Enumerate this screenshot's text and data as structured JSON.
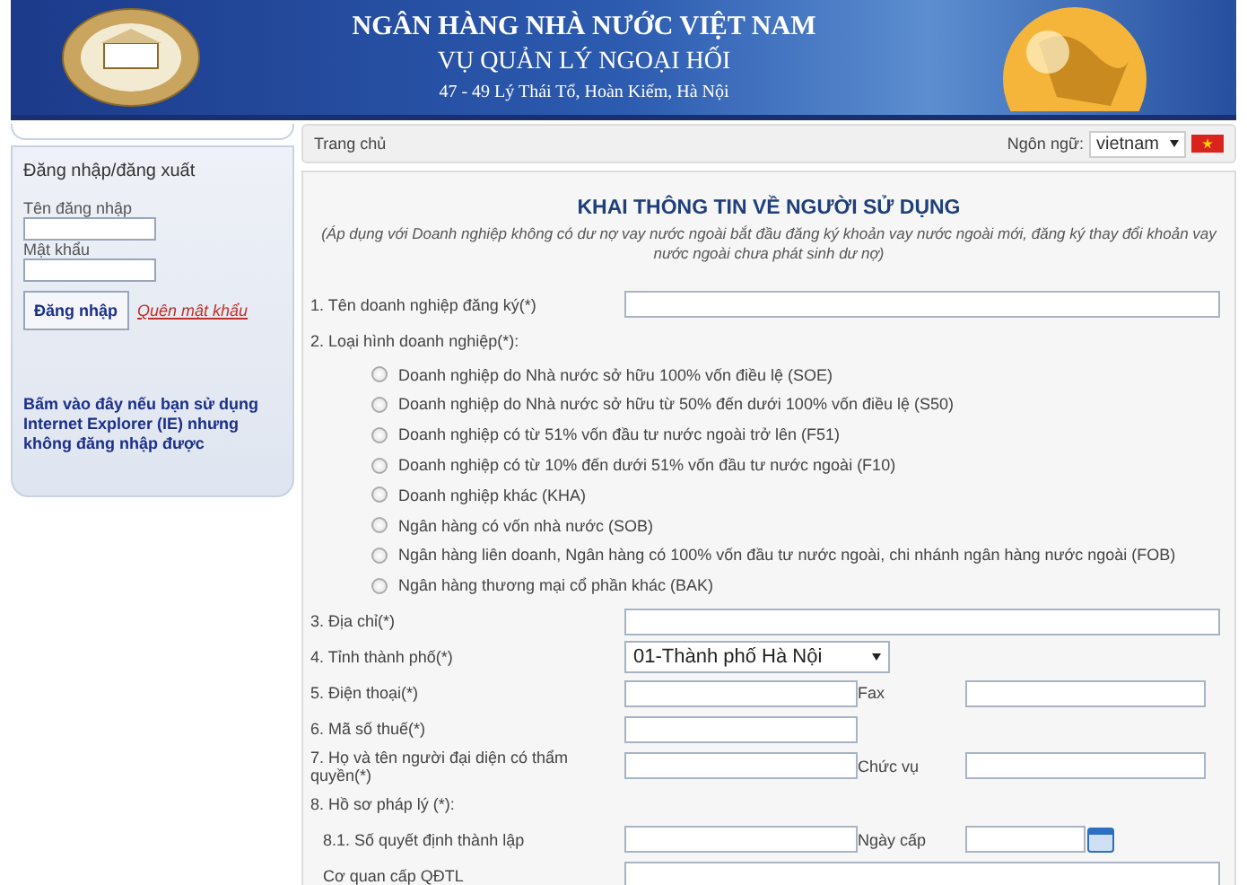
{
  "header": {
    "title": "NGÂN HÀNG NHÀ NƯỚC VIỆT NAM",
    "subtitle": "VỤ QUẢN LÝ NGOẠI HỐI",
    "address": "47 - 49 Lý Thái Tổ, Hoàn Kiếm, Hà Nội"
  },
  "sidebar": {
    "heading": "Đăng nhập/đăng xuất",
    "username_label": "Tên đăng nhập",
    "password_label": "Mật khẩu",
    "login_button": "Đăng nhập",
    "forgot_link": "Quên mật khẩu",
    "ie_note": "Bấm vào đây nếu bạn sử dụng Internet Explorer (IE) nhưng không đăng nhập được"
  },
  "breadcrumb": "Trang chủ",
  "language": {
    "label": "Ngôn ngữ:",
    "value": "vietnam"
  },
  "form": {
    "title": "KHAI THÔNG TIN VỀ NGƯỜI SỬ DỤNG",
    "note": "(Áp dụng với Doanh nghiệp không có dư nợ vay nước ngoài bắt đầu đăng ký khoản vay nước ngoài mới, đăng ký thay đổi khoản vay nước ngoài chưa phát sinh dư nợ)",
    "rows": [
      {
        "kind": "full",
        "label": "1. Tên doanh nghiệp đăng ký(*)"
      },
      {
        "kind": "radios",
        "label": "2. Loại hình doanh nghiệp(*):",
        "options": [
          {
            "label": "Doanh nghiệp do Nhà nước sở hữu 100% vốn điều lệ (SOE)",
            "selected": false
          },
          {
            "label": "Doanh nghiệp do Nhà nước sở hữu từ 50% đến dưới 100% vốn điều lệ (S50)",
            "selected": false
          },
          {
            "label": "Doanh nghiệp có từ 51% vốn đầu tư nước ngoài trở lên (F51)",
            "selected": false
          },
          {
            "label": "Doanh nghiệp có từ 10% đến dưới 51% vốn đầu tư nước ngoài (F10)",
            "selected": false
          },
          {
            "label": "Doanh nghiệp khác (KHA)",
            "selected": false
          },
          {
            "label": "Ngân hàng có vốn nhà nước (SOB)",
            "selected": false
          },
          {
            "label": "Ngân hàng liên doanh, Ngân hàng có 100% vốn đầu tư nước ngoài, chi nhánh ngân hàng nước ngoài (FOB)",
            "selected": false
          },
          {
            "label": "Ngân hàng thương mại cổ phần khác (BAK)",
            "selected": false
          }
        ]
      },
      {
        "kind": "full",
        "label": "3. Địa chỉ(*)"
      },
      {
        "kind": "select",
        "label": "4. Tỉnh thành phố(*)",
        "value": "01-Thành phố Hà Nội"
      },
      {
        "kind": "pair",
        "label": "5. Điện thoại(*)",
        "label2": "Fax"
      },
      {
        "kind": "short",
        "label": "6. Mã số thuế(*)"
      },
      {
        "kind": "pair",
        "label": "7. Họ và tên người đại diện có thẩm quyền(*)",
        "label2": "Chức vụ"
      },
      {
        "kind": "heading",
        "label": "8. Hồ sơ pháp lý (*):"
      },
      {
        "kind": "date_pair",
        "label": "8.1. Số quyết định thành lập",
        "label2": "Ngày cấp"
      },
      {
        "kind": "full_indent",
        "label": "Cơ quan cấp QĐTL"
      }
    ]
  }
}
